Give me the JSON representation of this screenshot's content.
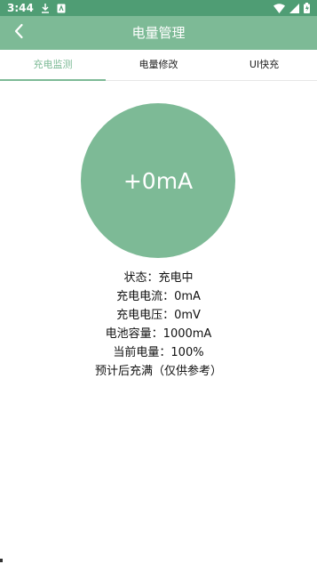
{
  "status_bar": {
    "time": "3:44",
    "icons": [
      "download-icon",
      "notification-app-icon",
      "wifi-icon",
      "signal-icon",
      "battery-icon"
    ]
  },
  "app_bar": {
    "title": "电量管理",
    "back_icon": "chevron-left-icon"
  },
  "tabs": [
    {
      "label": "充电监测",
      "active": true
    },
    {
      "label": "电量修改",
      "active": false
    },
    {
      "label": "UI快充",
      "active": false
    }
  ],
  "monitor": {
    "current_display": "+0mA",
    "lines": [
      "状态：充电中",
      "充电电流：0mA",
      "充电电压：0mV",
      "电池容量：1000mA",
      "当前电量：100%",
      "预计后充满（仅供参考）"
    ]
  },
  "colors": {
    "accent": "#7dba96",
    "status_bar": "#4f9d74"
  }
}
